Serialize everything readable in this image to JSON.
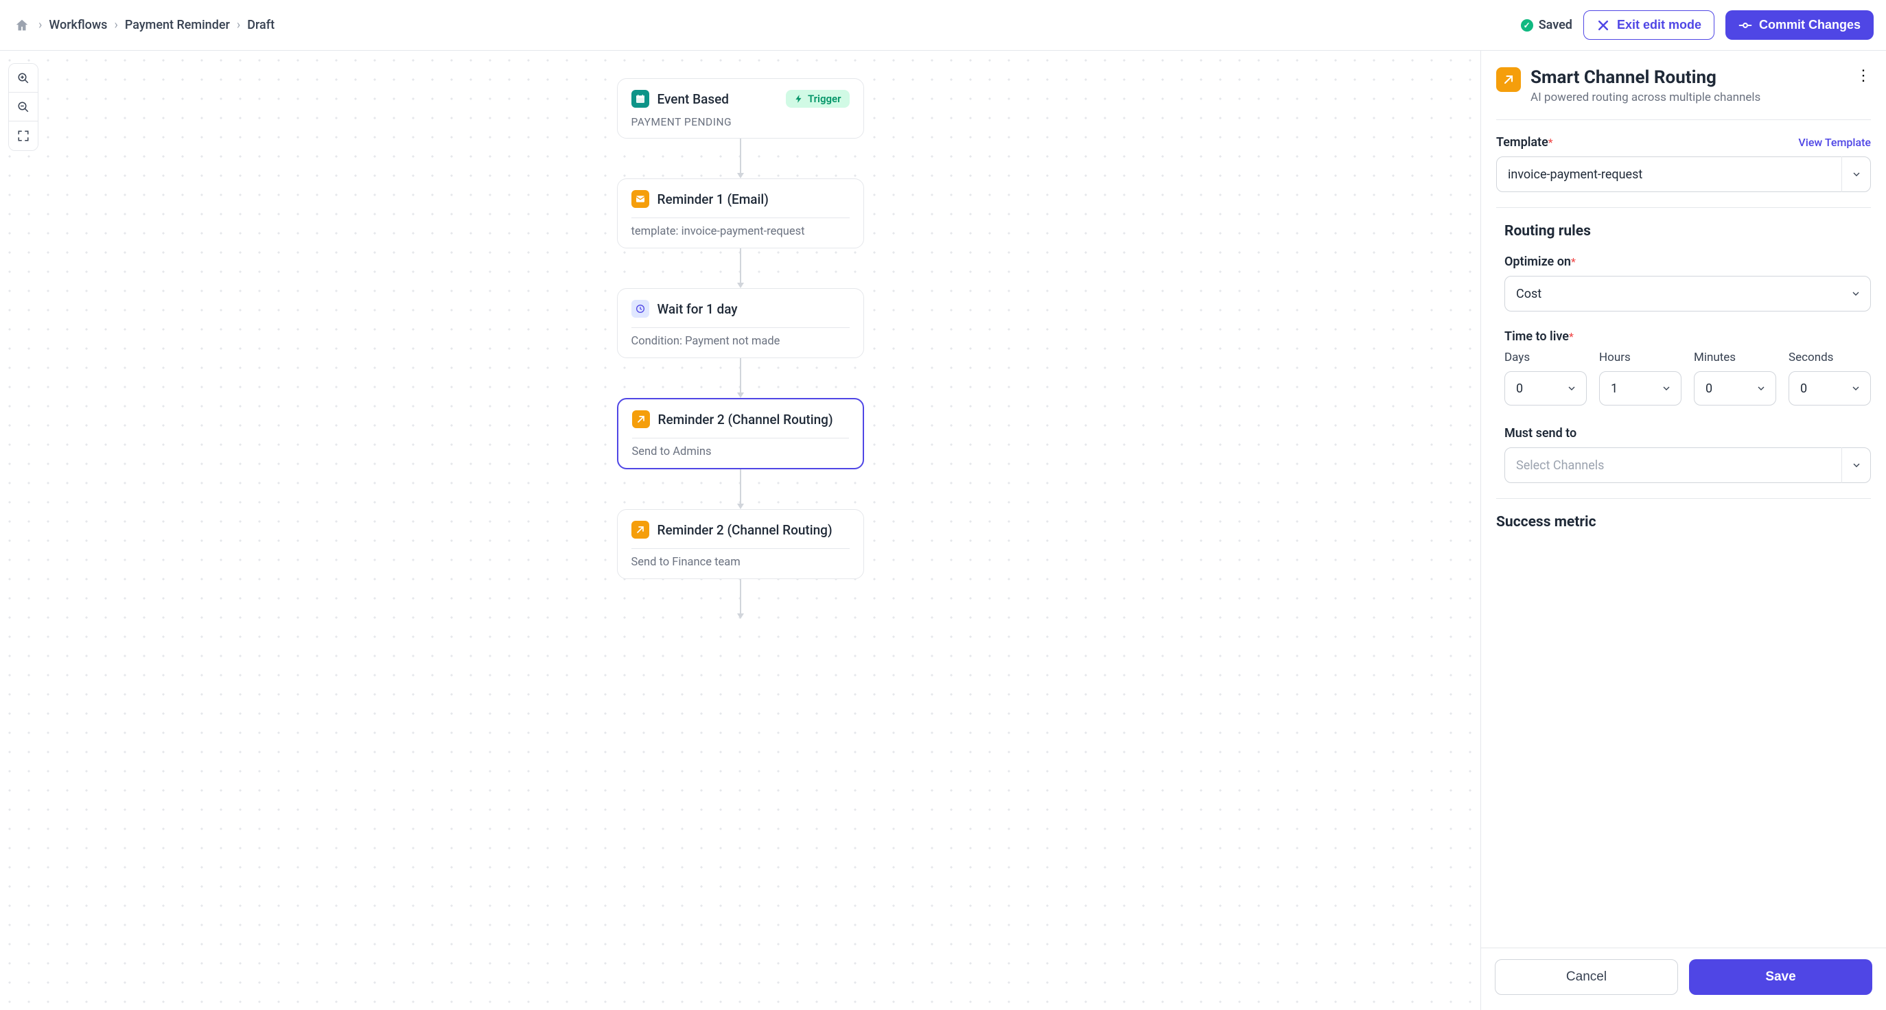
{
  "header": {
    "breadcrumbs": [
      "Workflows",
      "Payment Reminder",
      "Draft"
    ],
    "saved_label": "Saved",
    "exit_label": "Exit edit mode",
    "commit_label": "Commit Changes"
  },
  "flow": {
    "nodes": [
      {
        "title": "Event Based",
        "sub": "PAYMENT PENDING",
        "badge": "Trigger",
        "icon": "calendar",
        "color": "green",
        "type": "trigger"
      },
      {
        "title": "Reminder 1 (Email)",
        "sub": "template: invoice-payment-request",
        "icon": "mail",
        "color": "orange",
        "type": "step"
      },
      {
        "title": "Wait for 1 day",
        "sub": "Condition: Payment not made",
        "icon": "clock",
        "color": "blue",
        "type": "step"
      },
      {
        "title": "Reminder 2 (Channel Routing)",
        "sub": "Send to Admins",
        "icon": "route",
        "color": "orange",
        "type": "step",
        "selected": true
      },
      {
        "title": "Reminder 2 (Channel Routing)",
        "sub": "Send to Finance team",
        "icon": "route",
        "color": "orange",
        "type": "step"
      }
    ]
  },
  "side": {
    "title": "Smart Channel Routing",
    "subtitle": "AI powered routing across multiple channels",
    "template_label": "Template",
    "view_template": "View Template",
    "template_value": "invoice-payment-request",
    "routing_rules_heading": "Routing rules",
    "optimize_label": "Optimize on",
    "optimize_value": "Cost",
    "ttl_label": "Time to live",
    "ttl": {
      "days_label": "Days",
      "days": "0",
      "hours_label": "Hours",
      "hours": "1",
      "minutes_label": "Minutes",
      "minutes": "0",
      "seconds_label": "Seconds",
      "seconds": "0"
    },
    "must_send_label": "Must send to",
    "must_send_placeholder": "Select Channels",
    "success_metric_heading": "Success metric",
    "cancel": "Cancel",
    "save": "Save"
  }
}
